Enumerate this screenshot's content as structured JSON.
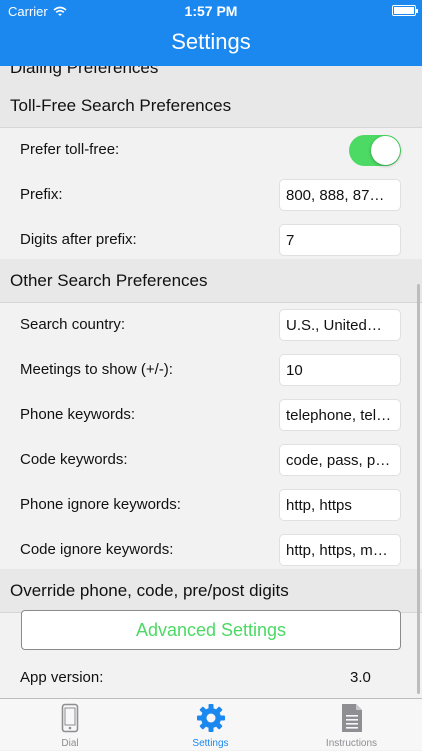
{
  "status_bar": {
    "carrier": "Carrier",
    "time": "1:57 PM"
  },
  "nav": {
    "title": "Settings"
  },
  "partial_section": {
    "label": "Dialing Preferences"
  },
  "toll_free": {
    "header": "Toll-Free Search Preferences",
    "prefer_label": "Prefer toll-free:",
    "prefer_on": true,
    "prefix_label": "Prefix:",
    "prefix_value": "800, 888, 87…",
    "digits_label": "Digits after prefix:",
    "digits_value": "7"
  },
  "other": {
    "header": "Other Search Preferences",
    "rows": [
      {
        "label": "Search country:",
        "value": "U.S., United…"
      },
      {
        "label": "Meetings to show (+/-):",
        "value": "10"
      },
      {
        "label": "Phone keywords:",
        "value": "telephone, tel…"
      },
      {
        "label": "Code keywords:",
        "value": "code, pass, p…"
      },
      {
        "label": "Phone ignore keywords:",
        "value": "http, https"
      },
      {
        "label": "Code ignore keywords:",
        "value": "http, https, m…"
      }
    ]
  },
  "override": {
    "header": "Override phone, code, pre/post digits",
    "button_label": "Advanced Settings"
  },
  "app_version": {
    "label": "App version:",
    "value": "3.0"
  },
  "tabs": [
    {
      "label": "Dial",
      "icon": "phone-icon"
    },
    {
      "label": "Settings",
      "icon": "gear-icon",
      "active": true
    },
    {
      "label": "Instructions",
      "icon": "document-icon"
    }
  ],
  "colors": {
    "brand": "#1b88f0",
    "toggle_on": "#4cd964",
    "button_text": "#4cd964"
  }
}
